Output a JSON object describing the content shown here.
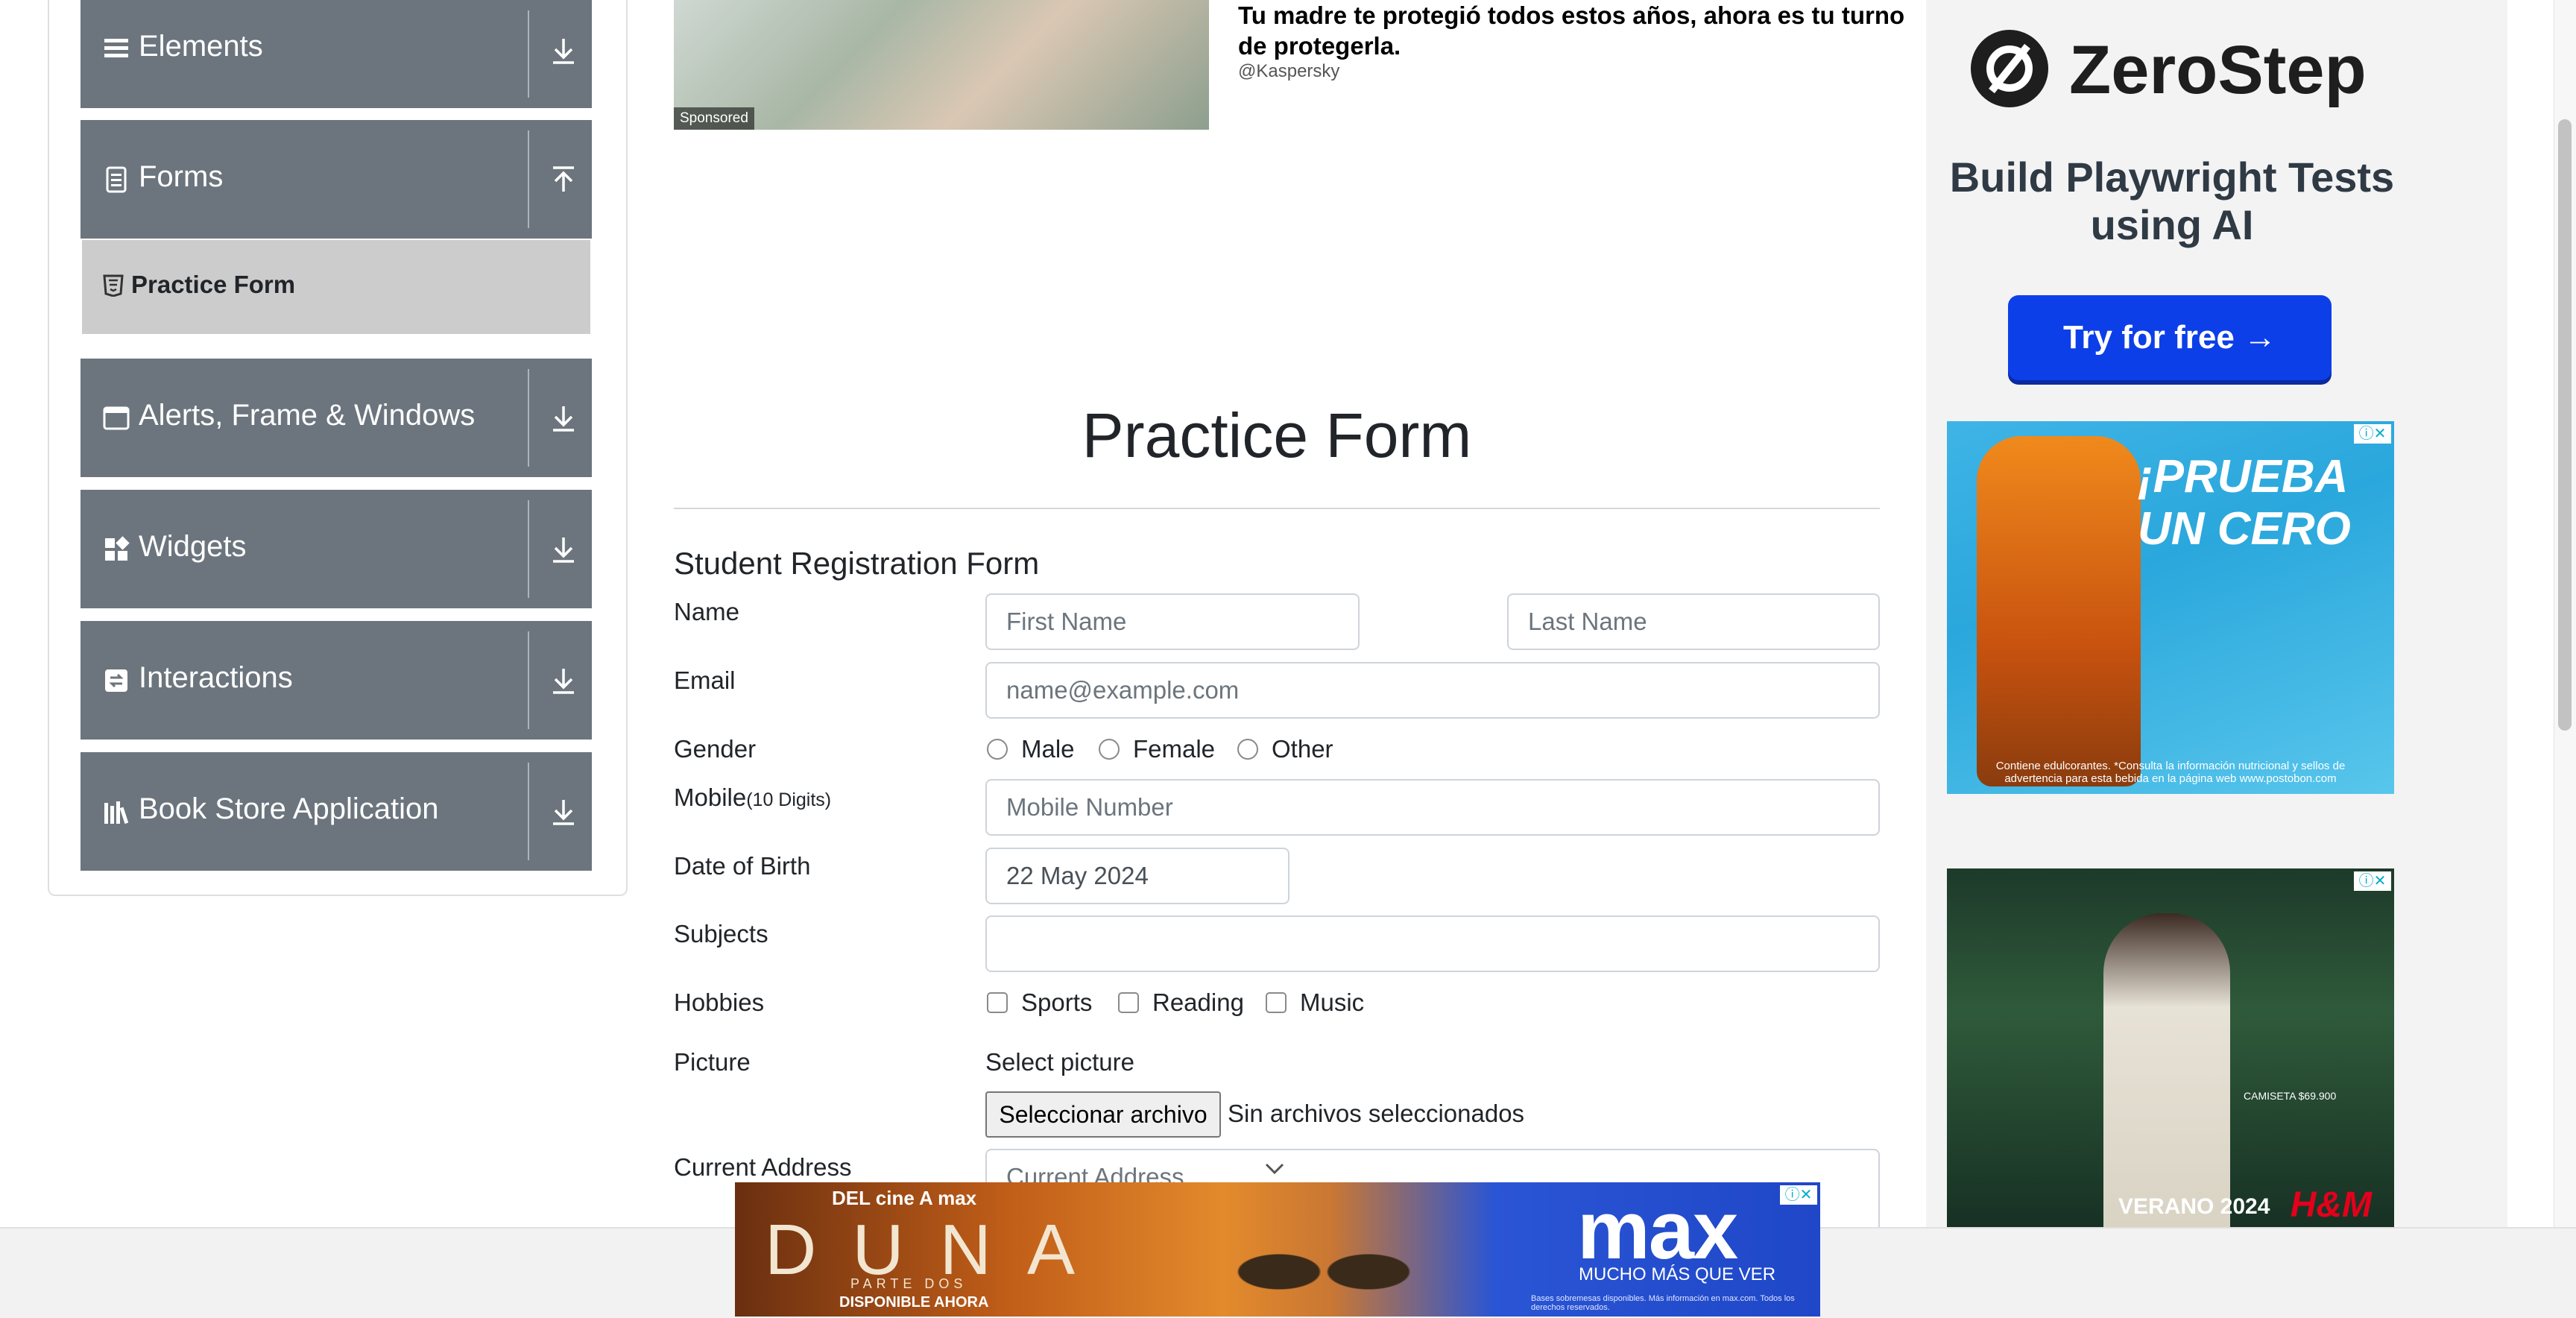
{
  "sidebar": {
    "groups": [
      {
        "label": "Elements",
        "icon": "list-icon",
        "arrow": "arrow-down"
      },
      {
        "label": "Forms",
        "icon": "form-icon",
        "arrow": "arrow-up"
      },
      {
        "label": "Alerts, Frame & Windows",
        "icon": "window-icon",
        "arrow": "arrow-down"
      },
      {
        "label": "Widgets",
        "icon": "widgets-icon",
        "arrow": "arrow-down"
      },
      {
        "label": "Interactions",
        "icon": "interactions-icon",
        "arrow": "arrow-down"
      },
      {
        "label": "Book Store Application",
        "icon": "books-icon",
        "arrow": "arrow-down"
      }
    ],
    "active_item": {
      "label": "Practice Form",
      "icon": "html5-icon"
    }
  },
  "top_ad": {
    "title": "Tu madre te protegió todos estos años, ahora es tu turno de protegerla.",
    "advertiser": "@Kaspersky",
    "badge": "Sponsored"
  },
  "page": {
    "title": "Practice Form",
    "form_title": "Student Registration Form"
  },
  "form": {
    "name_label": "Name",
    "first_name_placeholder": "First Name",
    "last_name_placeholder": "Last Name",
    "email_label": "Email",
    "email_placeholder": "name@example.com",
    "gender_label": "Gender",
    "gender_options": [
      "Male",
      "Female",
      "Other"
    ],
    "mobile_label": "Mobile",
    "mobile_hint": "(10 Digits)",
    "mobile_placeholder": "Mobile Number",
    "dob_label": "Date of Birth",
    "dob_value": "22 May 2024",
    "subjects_label": "Subjects",
    "hobbies_label": "Hobbies",
    "hobby_options": [
      "Sports",
      "Reading",
      "Music"
    ],
    "picture_label": "Picture",
    "select_picture": "Select picture",
    "file_button": "Seleccionar archivo",
    "file_status": "Sin archivos seleccionados",
    "address_label": "Current Address",
    "address_placeholder": "Current Address"
  },
  "right_ads": {
    "zerostep": {
      "brand": "ZeroStep",
      "tagline": "Build Playwright Tests using AI",
      "cta": "Try for free →"
    },
    "tea_ad": {
      "headline": "¡PRUEBA UN CERO",
      "fineprint": "Contiene edulcorantes. *Consulta la información nutricional y sellos de advertencia para esta bebida en la página web www.postobon.com"
    },
    "hm_ad": {
      "caption": "VERANO 2024",
      "brand": "H&M",
      "price": "CAMISETA $69.900"
    }
  },
  "bottom_ad": {
    "tagline": "DEL cine A max",
    "title": "DUNA",
    "subtitle": "PARTE DOS",
    "availability": "DISPONIBLE AHORA",
    "brand": "max",
    "slogan": "MUCHO MÁS QUE VER",
    "fineprint": "Bases sobremesas disponibles. Más información en max.com. Todos los derechos reservados."
  },
  "colors": {
    "sidebar_group_bg": "#6c757d",
    "active_item_bg": "#cccccc",
    "cta_blue": "#0d3fe8"
  }
}
